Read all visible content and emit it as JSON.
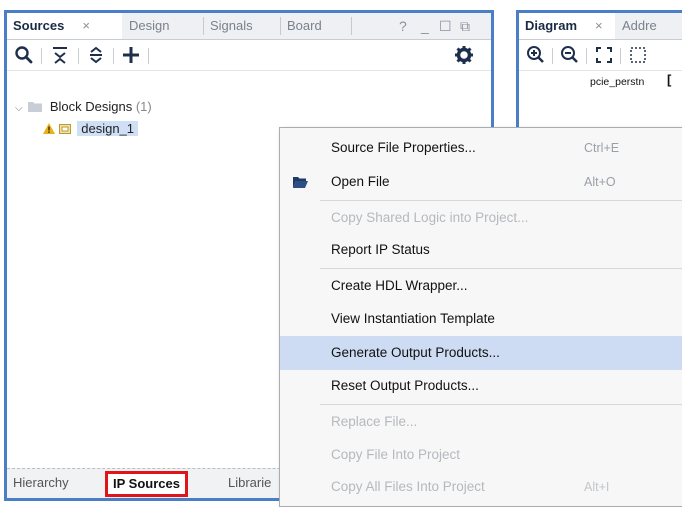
{
  "sources": {
    "tabs": [
      {
        "label": "Sources",
        "close": "×",
        "active": true
      },
      {
        "label": "Design"
      },
      {
        "label": "Signals"
      },
      {
        "label": "Board"
      }
    ],
    "window_controls": {
      "help": "?",
      "minimize": "_",
      "restore": "☐",
      "float": "⧉"
    },
    "toolbar_icons": [
      "search-icon",
      "collapse-all-icon",
      "expand-all-icon",
      "add-icon",
      "gear-icon"
    ],
    "tree": {
      "folder_label": "Block Designs",
      "folder_count": "(1)",
      "item_label": "design_1"
    },
    "bottom_tabs": [
      {
        "label": "Hierarchy"
      },
      {
        "label": "IP Sources",
        "active": true
      },
      {
        "label": "Librarie"
      }
    ]
  },
  "diagram": {
    "tabs": [
      {
        "label": "Diagram",
        "close": "×",
        "active": true
      },
      {
        "label": "Addre"
      }
    ],
    "toolbar_icons": [
      "zoom-in-icon",
      "zoom-out-icon",
      "fit-view-icon",
      "select-area-icon"
    ],
    "port_label": "pcie_perstn"
  },
  "context_menu": {
    "items": [
      {
        "label": "Source File Properties...",
        "shortcut": "Ctrl+E",
        "enabled": true
      },
      {
        "label": "Open File",
        "shortcut": "Alt+O",
        "enabled": true,
        "icon": "folder-icon"
      },
      {
        "label": "Copy Shared Logic into Project...",
        "shortcut": "",
        "enabled": false
      },
      {
        "label": "Report IP Status",
        "shortcut": "",
        "enabled": true
      },
      {
        "label": "Create HDL Wrapper...",
        "shortcut": "",
        "enabled": true
      },
      {
        "label": "View Instantiation Template",
        "shortcut": "",
        "enabled": true
      },
      {
        "label": "Generate Output Products...",
        "shortcut": "",
        "enabled": true,
        "highlighted": true
      },
      {
        "label": "Reset Output Products...",
        "shortcut": "",
        "enabled": true
      },
      {
        "label": "Replace File...",
        "shortcut": "",
        "enabled": false
      },
      {
        "label": "Copy File Into Project",
        "shortcut": "",
        "enabled": false
      },
      {
        "label": "Copy All Files Into Project",
        "shortcut": "Alt+I",
        "enabled": false
      }
    ]
  },
  "colors": {
    "pane_border": "#4a7ec7",
    "selection": "#cfe0f6",
    "menu_highlight": "#cddcf2",
    "active_tab_outline": "#e0141b"
  }
}
